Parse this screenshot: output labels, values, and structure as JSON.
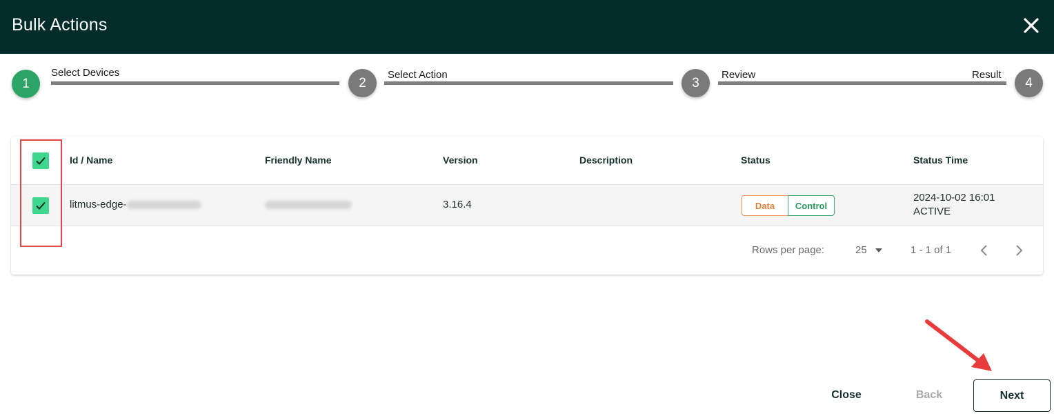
{
  "header": {
    "title": "Bulk Actions",
    "close_icon": "close-icon"
  },
  "stepper": {
    "steps": [
      {
        "number": "1",
        "label": "Select Devices",
        "state": "active"
      },
      {
        "number": "2",
        "label": "Select Action",
        "state": "inactive"
      },
      {
        "number": "3",
        "label": "Review",
        "state": "inactive"
      },
      {
        "number": "4",
        "label": "Result",
        "state": "inactive"
      }
    ]
  },
  "table": {
    "columns": [
      "Id / Name",
      "Friendly Name",
      "Version",
      "Description",
      "Status",
      "Status Time"
    ],
    "rows": [
      {
        "checked": true,
        "id_name_prefix": "litmus-edge-",
        "version": "3.16.4",
        "description": "",
        "status_chips": [
          "Data",
          "Control"
        ],
        "status_time": "2024-10-02 16:01",
        "status_state": "ACTIVE"
      }
    ],
    "pagination": {
      "rows_per_page_label": "Rows per page:",
      "rows_per_page_value": "25",
      "range": "1 - 1 of 1"
    }
  },
  "actions": {
    "close": "Close",
    "back": "Back",
    "next": "Next"
  },
  "colors": {
    "header_bg": "#022c2a",
    "accent_green": "#2aa566",
    "checkbox": "#3fd68d",
    "annotation_red": "#e04848"
  }
}
